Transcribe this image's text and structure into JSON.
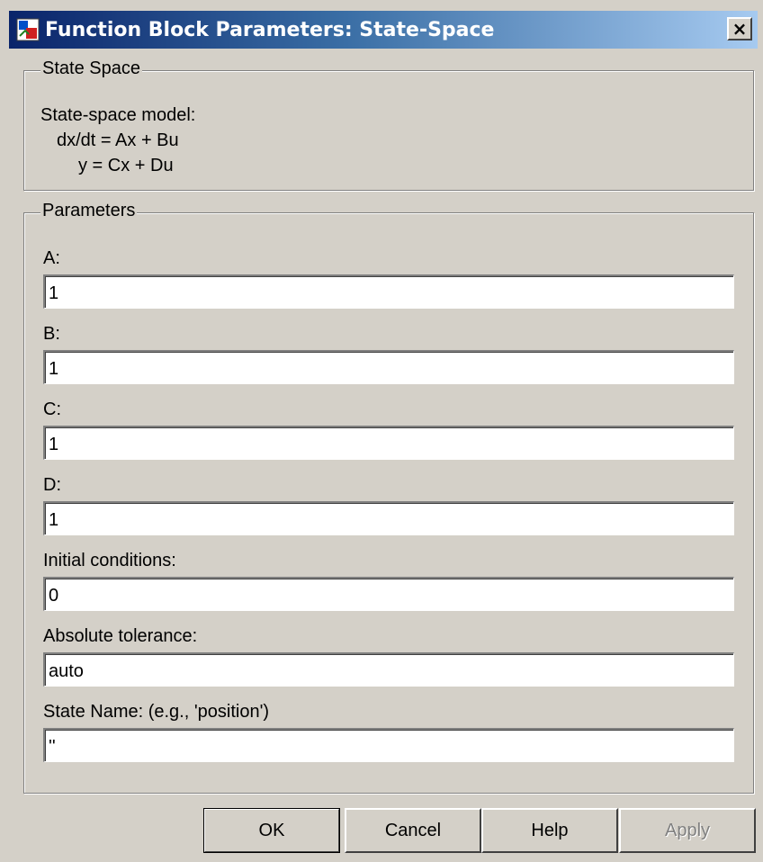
{
  "window": {
    "title": "Function Block Parameters: State-Space",
    "close_label": "×",
    "icon": "simulink-block-icon"
  },
  "state_space_group": {
    "legend": "State Space",
    "lines": [
      "State-space model:",
      "dx/dt = Ax + Bu",
      "y = Cx + Du"
    ]
  },
  "parameters_group": {
    "legend": "Parameters",
    "fields": [
      {
        "label": "A:",
        "value": "1"
      },
      {
        "label": "B:",
        "value": "1"
      },
      {
        "label": "C:",
        "value": "1"
      },
      {
        "label": "D:",
        "value": "1"
      },
      {
        "label": "Initial conditions:",
        "value": "0"
      },
      {
        "label": "Absolute tolerance:",
        "value": "auto"
      },
      {
        "label": "State Name: (e.g., 'position')",
        "value": "''"
      }
    ]
  },
  "buttons": {
    "ok": "OK",
    "cancel": "Cancel",
    "help": "Help",
    "apply": "Apply"
  }
}
